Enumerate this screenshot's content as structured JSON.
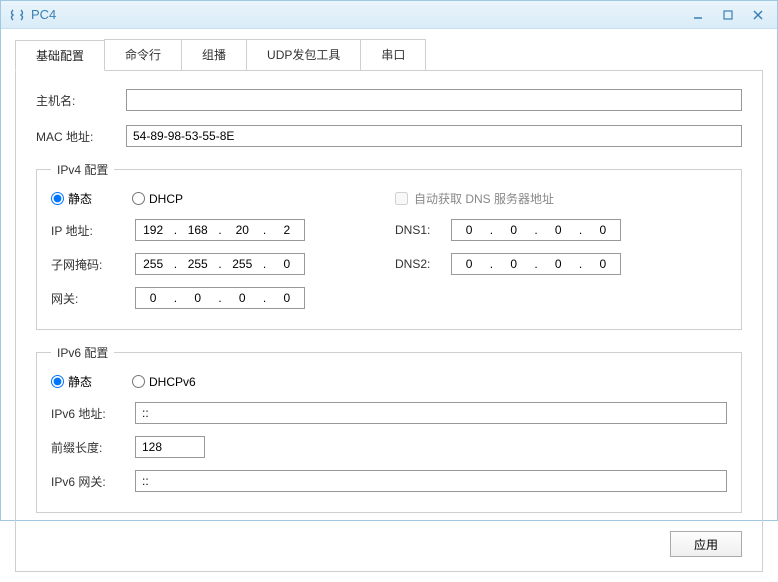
{
  "window": {
    "title": "PC4"
  },
  "tabs": {
    "basic": "基础配置",
    "cmd": "命令行",
    "multicast": "组播",
    "udp": "UDP发包工具",
    "serial": "串口"
  },
  "host": {
    "hostname_label": "主机名:",
    "hostname_value": "",
    "mac_label": "MAC 地址:",
    "mac_value": "54-89-98-53-55-8E"
  },
  "ipv4": {
    "legend": "IPv4 配置",
    "static_label": "静态",
    "dhcp_label": "DHCP",
    "autodns_label": "自动获取 DNS 服务器地址",
    "ip_label": "IP 地址:",
    "ip": [
      "192",
      "168",
      "20",
      "2"
    ],
    "mask_label": "子网掩码:",
    "mask": [
      "255",
      "255",
      "255",
      "0"
    ],
    "gw_label": "网关:",
    "gw": [
      "0",
      "0",
      "0",
      "0"
    ],
    "dns1_label": "DNS1:",
    "dns1": [
      "0",
      "0",
      "0",
      "0"
    ],
    "dns2_label": "DNS2:",
    "dns2": [
      "0",
      "0",
      "0",
      "0"
    ]
  },
  "ipv6": {
    "legend": "IPv6 配置",
    "static_label": "静态",
    "dhcpv6_label": "DHCPv6",
    "addr_label": "IPv6 地址:",
    "addr_value": "::",
    "prefix_label": "前缀长度:",
    "prefix_value": "128",
    "gw_label": "IPv6 网关:",
    "gw_value": "::"
  },
  "buttons": {
    "apply": "应用"
  }
}
